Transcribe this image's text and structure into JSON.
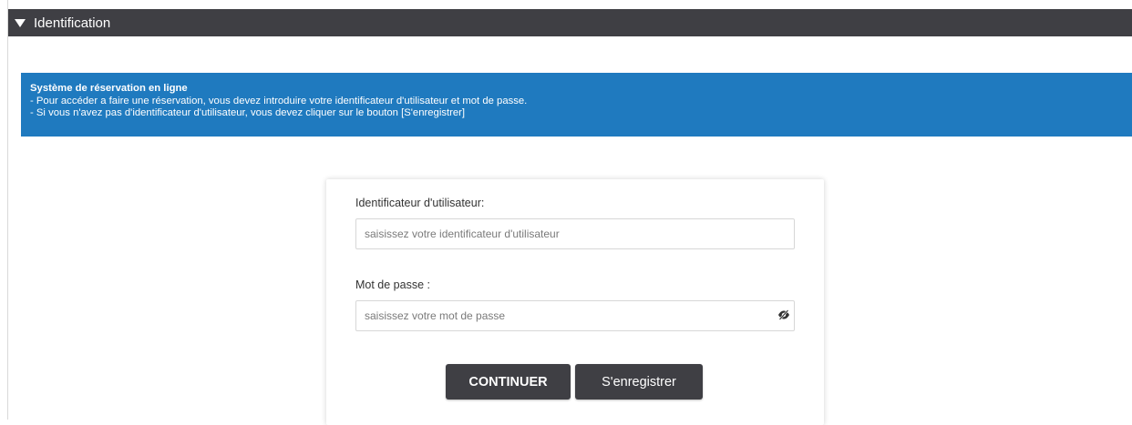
{
  "section": {
    "title": "Identification"
  },
  "banner": {
    "title": "Système de réservation en ligne",
    "line1": "- Pour accéder a faire une réservation, vous devez introduire votre identificateur d'utilisateur et mot de passe.",
    "line2": "- Si vous n'avez pas d'identificateur d'utilisateur, vous devez cliquer sur le bouton [S'enregistrer]",
    "color": "#1f7abf"
  },
  "login": {
    "username_label": "Identificateur d'utilisateur:",
    "username_placeholder": "saisissez votre identificateur d'utilisateur",
    "username_value": "",
    "password_label": "Mot de passe :",
    "password_placeholder": "saisissez votre mot de passe",
    "password_value": "",
    "password_toggle_icon": "eye-slash-icon"
  },
  "buttons": {
    "continue_label": "CONTINUER",
    "register_label": "S'enregistrer",
    "color": "#3f3f44"
  }
}
